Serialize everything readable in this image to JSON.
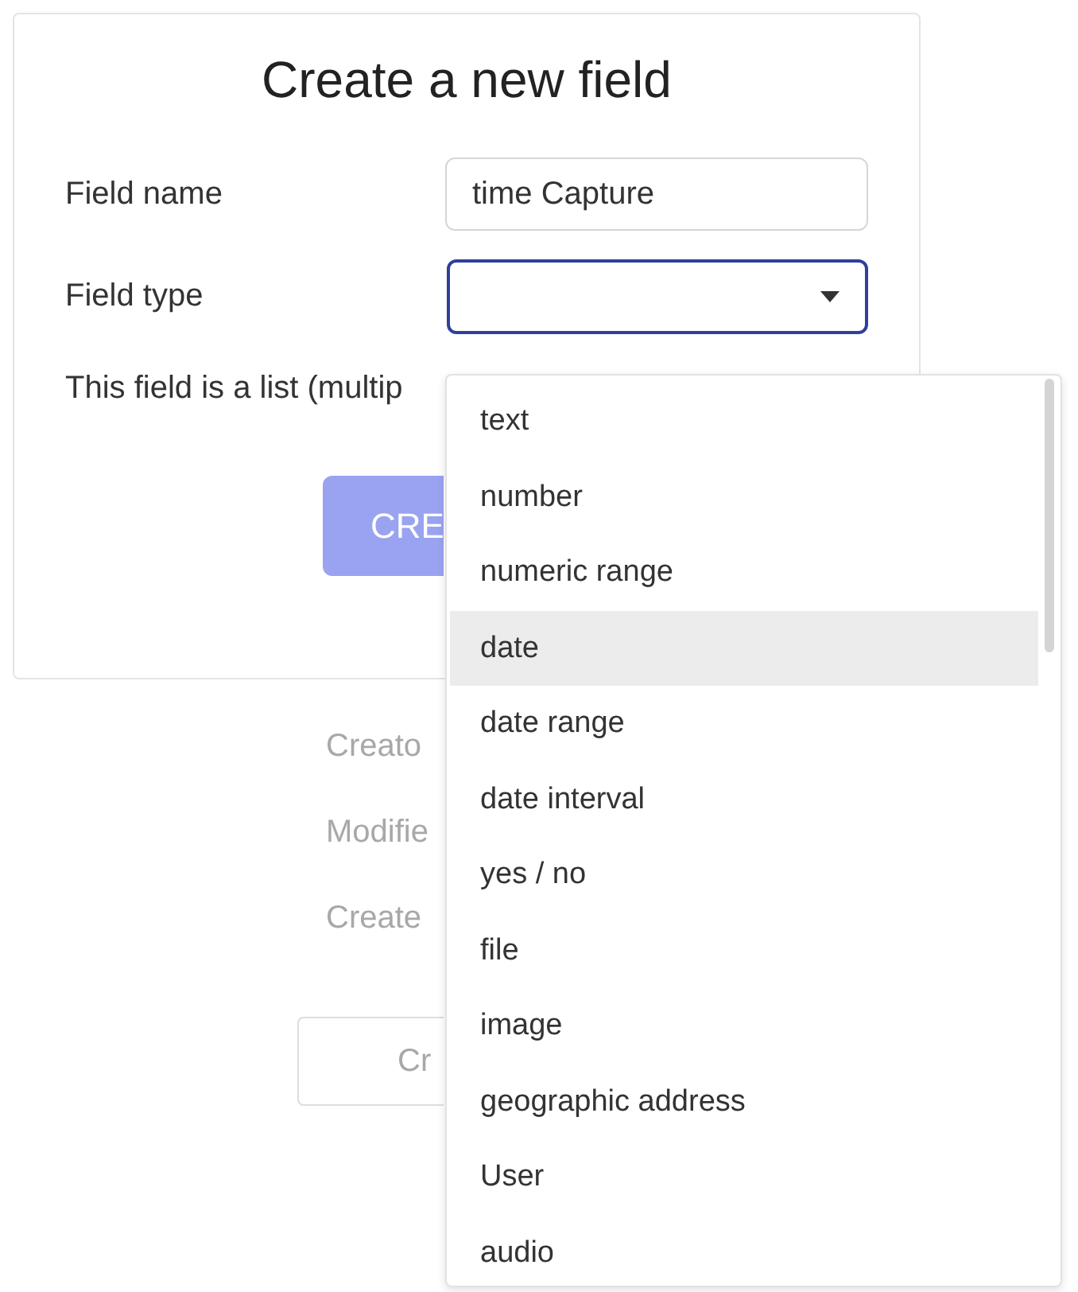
{
  "dialog": {
    "title": "Create a new field",
    "field_name": {
      "label": "Field name",
      "value": "time Capture"
    },
    "field_type": {
      "label": "Field type",
      "focused": true
    },
    "list_option": {
      "label": "This field is a list (multip"
    },
    "create_button": {
      "label": "CRE"
    }
  },
  "background": {
    "labels": [
      "Creato",
      "Modifie",
      "Create"
    ],
    "button": "Cr"
  },
  "dropdown": {
    "options": [
      {
        "label": "text",
        "highlighted": false
      },
      {
        "label": "number",
        "highlighted": false
      },
      {
        "label": "numeric range",
        "highlighted": false
      },
      {
        "label": "date",
        "highlighted": true
      },
      {
        "label": "date range",
        "highlighted": false
      },
      {
        "label": "date interval",
        "highlighted": false
      },
      {
        "label": "yes / no",
        "highlighted": false
      },
      {
        "label": "file",
        "highlighted": false
      },
      {
        "label": "image",
        "highlighted": false
      },
      {
        "label": "geographic address",
        "highlighted": false
      },
      {
        "label": "User",
        "highlighted": false
      },
      {
        "label": "audio",
        "highlighted": false
      }
    ]
  }
}
